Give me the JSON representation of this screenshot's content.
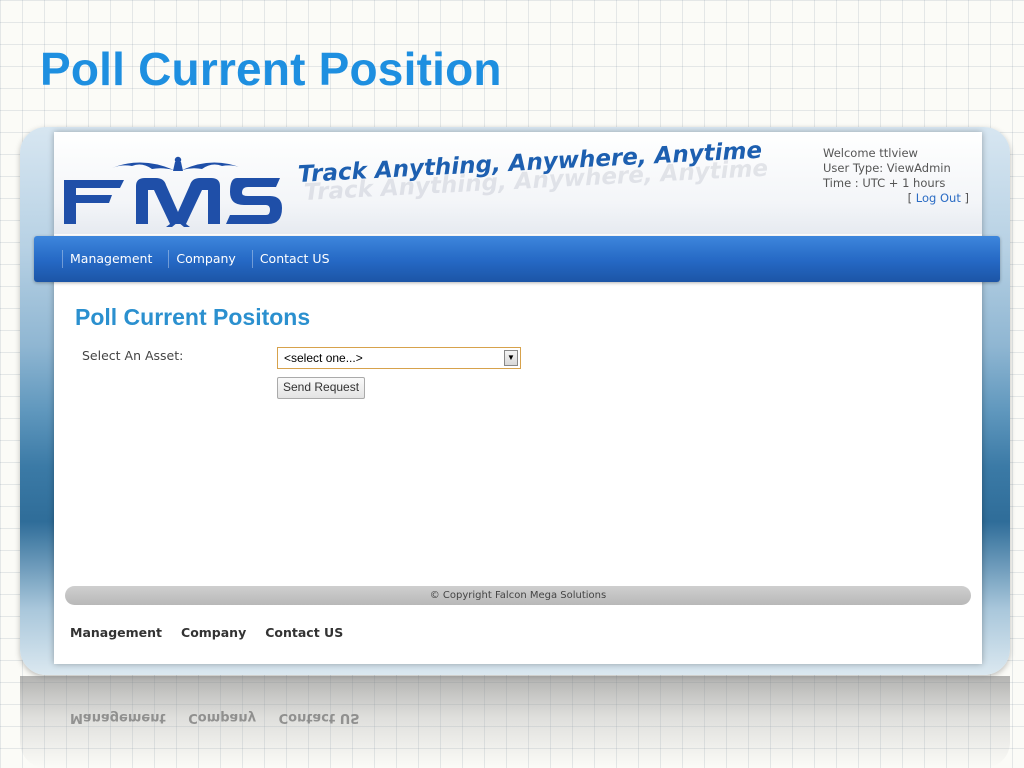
{
  "slide": {
    "title": "Poll Current Position"
  },
  "header": {
    "logo_text": "FMS",
    "tagline": "Track Anything, Anywhere, Anytime",
    "user": {
      "welcome": "Welcome ttlview",
      "user_type": "User Type: ViewAdmin",
      "time": "Time : UTC + 1 hours",
      "logout_open": "[ ",
      "logout_label": "Log Out",
      "logout_close": " ]"
    }
  },
  "nav": {
    "items": [
      "Management",
      "Company",
      "Contact US"
    ]
  },
  "main": {
    "heading": "Poll Current Positons",
    "asset_label": "Select An Asset:",
    "asset_select_value": "<select one...>",
    "send_button": "Send Request"
  },
  "footer": {
    "copyright": "© Copyright Falcon Mega Solutions",
    "links": [
      "Management",
      "Company",
      "Contact US"
    ]
  },
  "colors": {
    "title_blue": "#1e8fe0",
    "nav_blue": "#2568c4",
    "heading_blue": "#2b90cf",
    "select_border": "#d7a24c"
  },
  "icons": {
    "logo": "fms-eagle-logo",
    "select_arrow": "chevron-down-icon"
  }
}
